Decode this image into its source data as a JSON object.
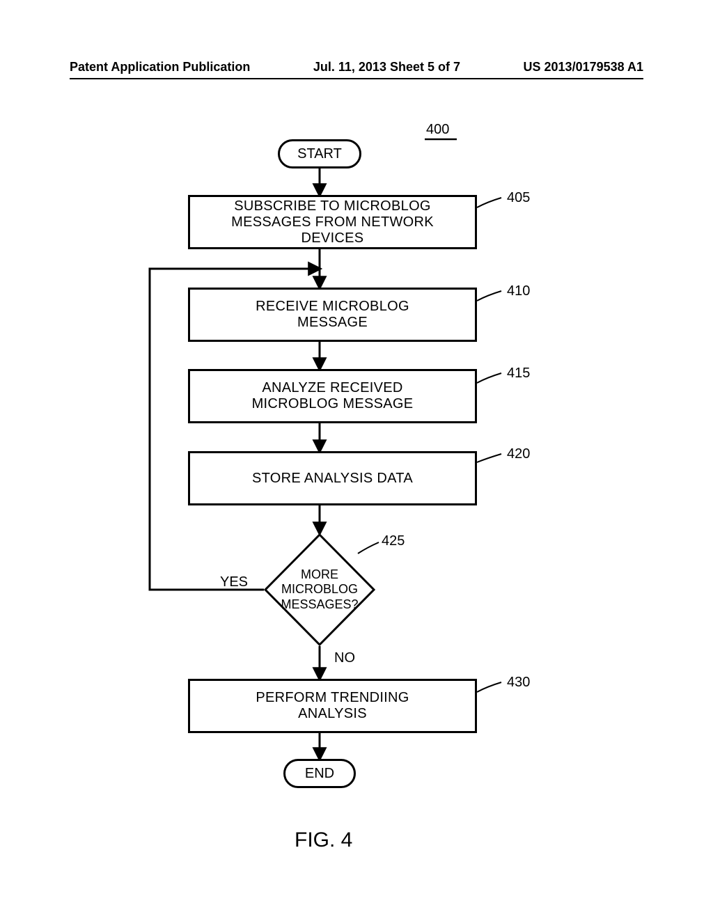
{
  "header": {
    "left": "Patent Application Publication",
    "center": "Jul. 11, 2013  Sheet 5 of 7",
    "right": "US 2013/0179538 A1"
  },
  "refs": {
    "r400": "400",
    "r405": "405",
    "r410": "410",
    "r415": "415",
    "r420": "420",
    "r425": "425",
    "r430": "430"
  },
  "nodes": {
    "start": "START",
    "n405": "SUBSCRIBE TO MICROBLOG MESSAGES FROM NETWORK DEVICES",
    "n410": "RECEIVE MICROBLOG MESSAGE",
    "n415": "ANALYZE RECEIVED MICROBLOG MESSAGE",
    "n420": "STORE ANALYSIS DATA",
    "n425": "MORE MICROBLOG MESSAGES?",
    "n430": "PERFORM TRENDIING ANALYSIS",
    "end": "END"
  },
  "edges": {
    "yes": "YES",
    "no": "NO"
  },
  "figure": "FIG. 4"
}
